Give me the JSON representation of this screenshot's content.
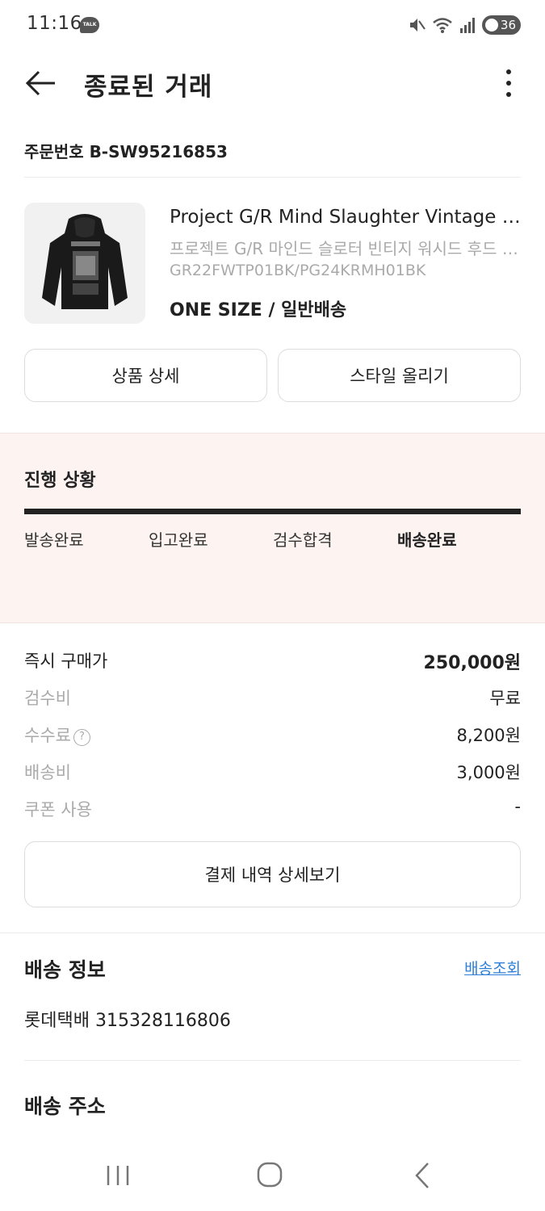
{
  "status_bar": {
    "time": "11:16",
    "talk_badge": "TALK",
    "battery": "36",
    "icons": [
      "mute-icon",
      "wifi-icon",
      "signal-icon",
      "battery-icon"
    ]
  },
  "header": {
    "title": "종료된 거래"
  },
  "order": {
    "number_label": "주문번호 B-SW95216853"
  },
  "product": {
    "name_en": "Project G/R Mind Slaughter Vintage Washed Hoodie Black",
    "name_ko": "프로젝트 G/R 마인드 슬로터 빈티지 워시드 후드 블랙",
    "code": "GR22FWTP01BK/PG24KRMH01BK",
    "option": "ONE SIZE / 일반배송"
  },
  "actions": {
    "detail_label": "상품 상세",
    "style_label": "스타일 올리기"
  },
  "progress": {
    "title": "진행 상황",
    "steps": [
      "발송완료",
      "입고완료",
      "검수합격",
      "배송완료"
    ],
    "active_step": "배송완료",
    "completion": 1.0
  },
  "price": {
    "rows": [
      {
        "label": "즉시 구매가",
        "value": "250,000원"
      },
      {
        "label": "검수비",
        "value": "무료"
      },
      {
        "label": "수수료",
        "value": "8,200원"
      },
      {
        "label": "배송비",
        "value": "3,000원"
      },
      {
        "label": "쿠폰 사용",
        "value": "-"
      }
    ],
    "help_symbol": "?",
    "payment_detail_label": "결제 내역 상세보기"
  },
  "shipping": {
    "title": "배송 정보",
    "track_label": "배송조회",
    "tracking": "롯데택배 315328116806"
  },
  "address": {
    "title": "배송 주소"
  },
  "colors": {
    "progress_bg": "#fdf4f2",
    "link": "#2f7fd8",
    "muted": "#aaaaaa"
  }
}
